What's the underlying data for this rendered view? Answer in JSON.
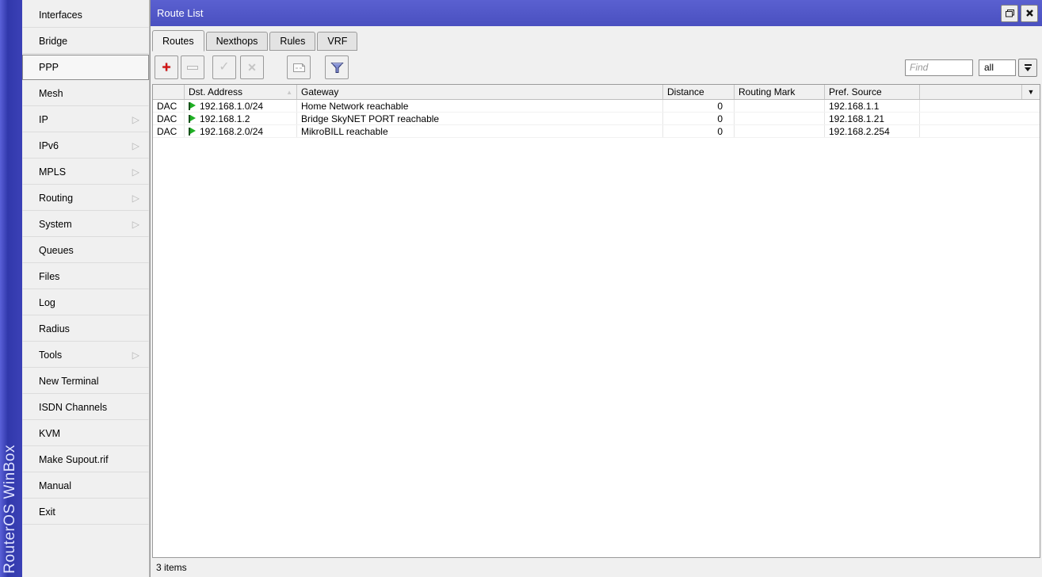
{
  "brand": {
    "vertical_text": "RouterOS WinBox"
  },
  "sidebar": {
    "items": [
      {
        "label": "Interfaces",
        "has_submenu": false,
        "selected": false
      },
      {
        "label": "Bridge",
        "has_submenu": false,
        "selected": false
      },
      {
        "label": "PPP",
        "has_submenu": false,
        "selected": true
      },
      {
        "label": "Mesh",
        "has_submenu": false,
        "selected": false
      },
      {
        "label": "IP",
        "has_submenu": true,
        "selected": false
      },
      {
        "label": "IPv6",
        "has_submenu": true,
        "selected": false
      },
      {
        "label": "MPLS",
        "has_submenu": true,
        "selected": false
      },
      {
        "label": "Routing",
        "has_submenu": true,
        "selected": false
      },
      {
        "label": "System",
        "has_submenu": true,
        "selected": false
      },
      {
        "label": "Queues",
        "has_submenu": false,
        "selected": false
      },
      {
        "label": "Files",
        "has_submenu": false,
        "selected": false
      },
      {
        "label": "Log",
        "has_submenu": false,
        "selected": false
      },
      {
        "label": "Radius",
        "has_submenu": false,
        "selected": false
      },
      {
        "label": "Tools",
        "has_submenu": true,
        "selected": false
      },
      {
        "label": "New Terminal",
        "has_submenu": false,
        "selected": false
      },
      {
        "label": "ISDN Channels",
        "has_submenu": false,
        "selected": false
      },
      {
        "label": "KVM",
        "has_submenu": false,
        "selected": false
      },
      {
        "label": "Make Supout.rif",
        "has_submenu": false,
        "selected": false
      },
      {
        "label": "Manual",
        "has_submenu": false,
        "selected": false
      },
      {
        "label": "Exit",
        "has_submenu": false,
        "selected": false
      }
    ],
    "submenu_arrow_glyph": "▷"
  },
  "window": {
    "title": "Route List"
  },
  "tabs": [
    {
      "label": "Routes",
      "active": true
    },
    {
      "label": "Nexthops",
      "active": false
    },
    {
      "label": "Rules",
      "active": false
    },
    {
      "label": "VRF",
      "active": false
    }
  ],
  "toolbar": {
    "buttons": [
      {
        "name": "add",
        "icon": "plus-icon",
        "enabled": true
      },
      {
        "name": "remove",
        "icon": "minus-icon",
        "enabled": false
      },
      {
        "name": "enable",
        "icon": "check-icon",
        "enabled": false
      },
      {
        "name": "disable",
        "icon": "cross-icon",
        "enabled": false
      },
      {
        "name": "comment",
        "icon": "comment-icon",
        "enabled": false
      },
      {
        "name": "filter",
        "icon": "funnel-icon",
        "enabled": true
      }
    ],
    "glyphs": {
      "plus": "+",
      "check": "✓",
      "cross": "✕"
    },
    "find_placeholder": "Find",
    "scope_value": "all"
  },
  "table": {
    "columns": [
      {
        "label": "",
        "key": "flags"
      },
      {
        "label": "Dst. Address",
        "key": "dst_address",
        "sorted": "asc"
      },
      {
        "label": "Gateway",
        "key": "gateway"
      },
      {
        "label": "Distance",
        "key": "distance"
      },
      {
        "label": "Routing Mark",
        "key": "routing_mark"
      },
      {
        "label": "Pref. Source",
        "key": "pref_source"
      },
      {
        "label": "",
        "key": "spacer"
      }
    ],
    "sort_indicator": "▲",
    "column_menu_glyph": "▼",
    "rows": [
      {
        "flags": "DAC",
        "dst_address": "192.168.1.0/24",
        "gateway": "Home Network reachable",
        "distance": "0",
        "routing_mark": "",
        "pref_source": "192.168.1.1"
      },
      {
        "flags": "DAC",
        "dst_address": "192.168.1.2",
        "gateway": "Bridge SkyNET PORT reachable",
        "distance": "0",
        "routing_mark": "",
        "pref_source": "192.168.1.21"
      },
      {
        "flags": "DAC",
        "dst_address": "192.168.2.0/24",
        "gateway": "MikroBILL reachable",
        "distance": "0",
        "routing_mark": "",
        "pref_source": "192.168.2.254"
      }
    ]
  },
  "status": {
    "text": "3 items"
  },
  "colors": {
    "titlebar_blue": "#4d53c3",
    "brand_strip_blue": "#3a40b4",
    "add_button_red": "#d41414",
    "route_flag_green": "#1fb024",
    "filter_funnel_blue": "#8490d4"
  }
}
